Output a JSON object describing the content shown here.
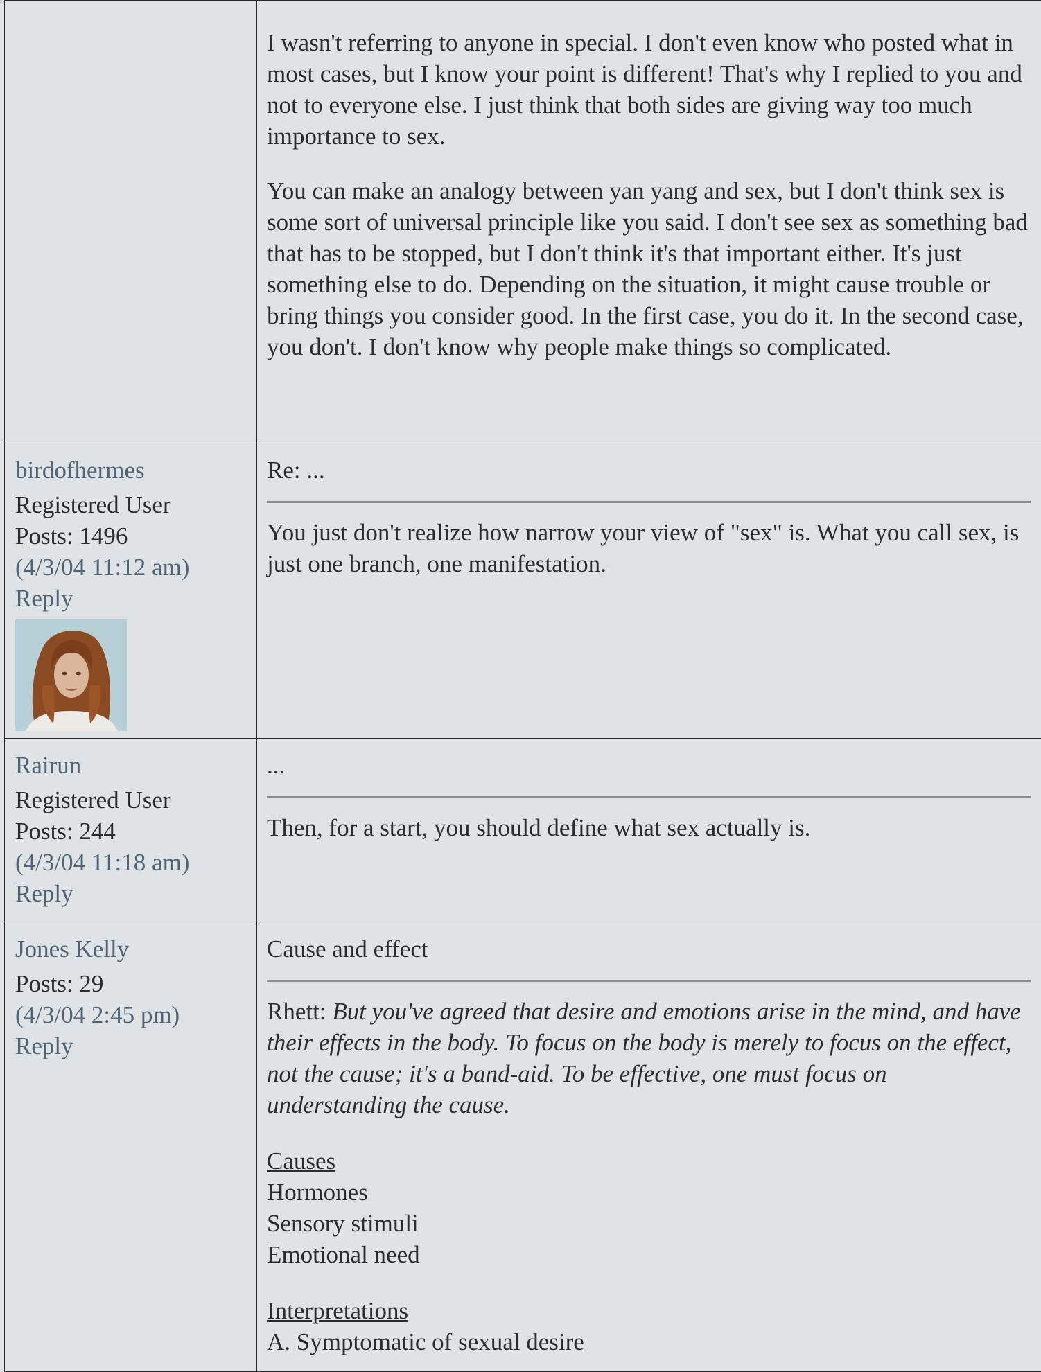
{
  "posts": [
    {
      "author": "",
      "paragraphs": [
        "I wasn't referring to anyone in special. I don't even know who posted what in most cases, but I know your point is different! That's why I replied to you and not to everyone else. I just think that both sides are giving way too much importance to sex.",
        "You can make an analogy between yan yang and sex, but I don't think sex is some sort of universal principle like you said. I don't see sex as something bad that has to be stopped, but I don't think it's that important either. It's just something else to do. Depending on the situation, it might cause trouble or bring things you consider good. In the first case, you do it. In the second case, you don't. I don't know why people make things so complicated."
      ]
    },
    {
      "author": "birdofhermes",
      "role": "Registered User",
      "posts_count": "Posts: 1496",
      "date": "(4/3/04 11:12 am)",
      "reply": "Reply",
      "title": "Re: ...",
      "paragraphs": [
        "You just don't realize how narrow your view of \"sex\" is. What you call sex, is just one branch, one manifestation."
      ]
    },
    {
      "author": "Rairun",
      "role": "Registered User",
      "posts_count": "Posts: 244",
      "date": "(4/3/04 11:18 am)",
      "reply": "Reply",
      "title": "...",
      "paragraphs": [
        "Then, for a start, you should define what sex actually is."
      ]
    },
    {
      "author": "Jones Kelly",
      "posts_count": "Posts: 29",
      "date": "(4/3/04 2:45 pm)",
      "reply": "Reply",
      "title": "Cause and effect",
      "quote_lead": "Rhett: ",
      "quote_text": "But you've agreed that desire and emotions arise in the mind, and have their effects in the body. To focus on the body is merely to focus on the effect, not the cause; it's a band-aid. To be effective, one must focus on understanding the cause.",
      "causes_heading": "Causes",
      "causes": [
        "Hormones",
        "Sensory stimuli",
        "Emotional need"
      ],
      "interp_heading": "Interpretations",
      "interpretations": [
        "A. Symptomatic of sexual desire"
      ]
    }
  ]
}
